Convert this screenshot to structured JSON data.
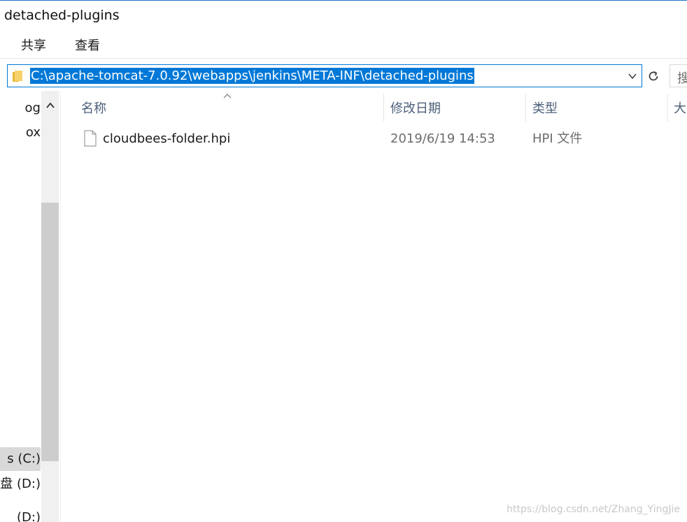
{
  "window": {
    "title": "detached-plugins"
  },
  "ribbon": {
    "tabs": [
      {
        "label": "共享"
      },
      {
        "label": "查看"
      }
    ]
  },
  "address": {
    "path": "C:\\apache-tomcat-7.0.92\\webapps\\jenkins\\META-INF\\detached-plugins"
  },
  "search": {
    "placeholder": "搜"
  },
  "nav": {
    "items": [
      {
        "label": "og"
      },
      {
        "label": "ox"
      },
      {
        "label": "s (C:)"
      },
      {
        "label": "盘 (D:)"
      },
      {
        "label": "(D:)"
      }
    ]
  },
  "filelist": {
    "columns": [
      {
        "label": "名称"
      },
      {
        "label": "修改日期"
      },
      {
        "label": "类型"
      },
      {
        "label": "大"
      }
    ],
    "rows": [
      {
        "name": "cloudbees-folder.hpi",
        "modified": "2019/6/19 14:53",
        "type": "HPI 文件"
      }
    ]
  },
  "watermark": "https://blog.csdn.net/Zhang_YingJie",
  "colors": {
    "accent": "#0078d7",
    "header_text": "#4c607a",
    "selected_nav": "#d9d9d9"
  }
}
